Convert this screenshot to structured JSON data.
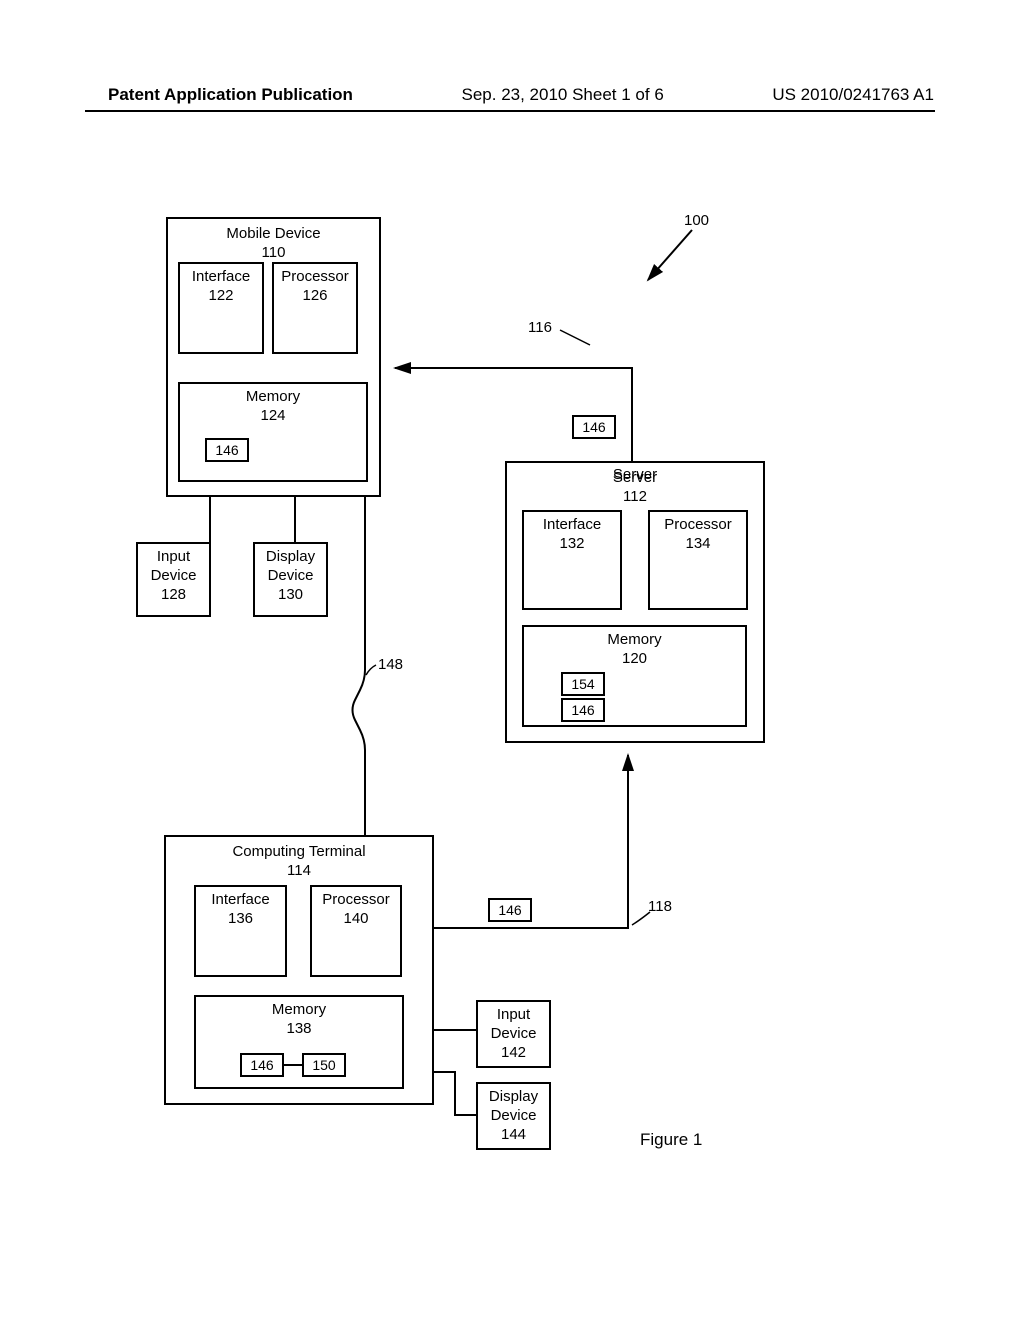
{
  "header": {
    "left": "Patent Application Publication",
    "center": "Sep. 23, 2010  Sheet 1 of 6",
    "right": "US 2010/0241763 A1"
  },
  "figure_label": "Figure 1",
  "system_ref": "100",
  "mobile": {
    "title1": "Mobile Device",
    "title2": "110",
    "interface1": "Interface",
    "interface2": "122",
    "processor1": "Processor",
    "processor2": "126",
    "memory1": "Memory",
    "memory2": "124",
    "mem_item": "146",
    "input1": "Input",
    "input2": "Device",
    "input3": "128",
    "display1": "Display",
    "display2": "Device",
    "display3": "130"
  },
  "server": {
    "title1": "Server",
    "title2": "112",
    "interface1": "Interface",
    "interface2": "132",
    "processor1": "Processor",
    "processor2": "134",
    "memory1": "Memory",
    "memory2": "120",
    "mem_item1": "154",
    "mem_item2": "146"
  },
  "terminal": {
    "title1": "Computing Terminal",
    "title2": "114",
    "interface1": "Interface",
    "interface2": "136",
    "processor1": "Processor",
    "processor2": "140",
    "memory1": "Memory",
    "memory2": "138",
    "mem_item1": "146",
    "mem_item2": "150",
    "input1": "Input",
    "input2": "Device",
    "input3": "142",
    "display1": "Display",
    "display2": "Device",
    "display3": "144"
  },
  "links": {
    "r116_label": "116",
    "r116_item": "146",
    "r118_label": "118",
    "r118_item": "146",
    "r148_label": "148"
  }
}
